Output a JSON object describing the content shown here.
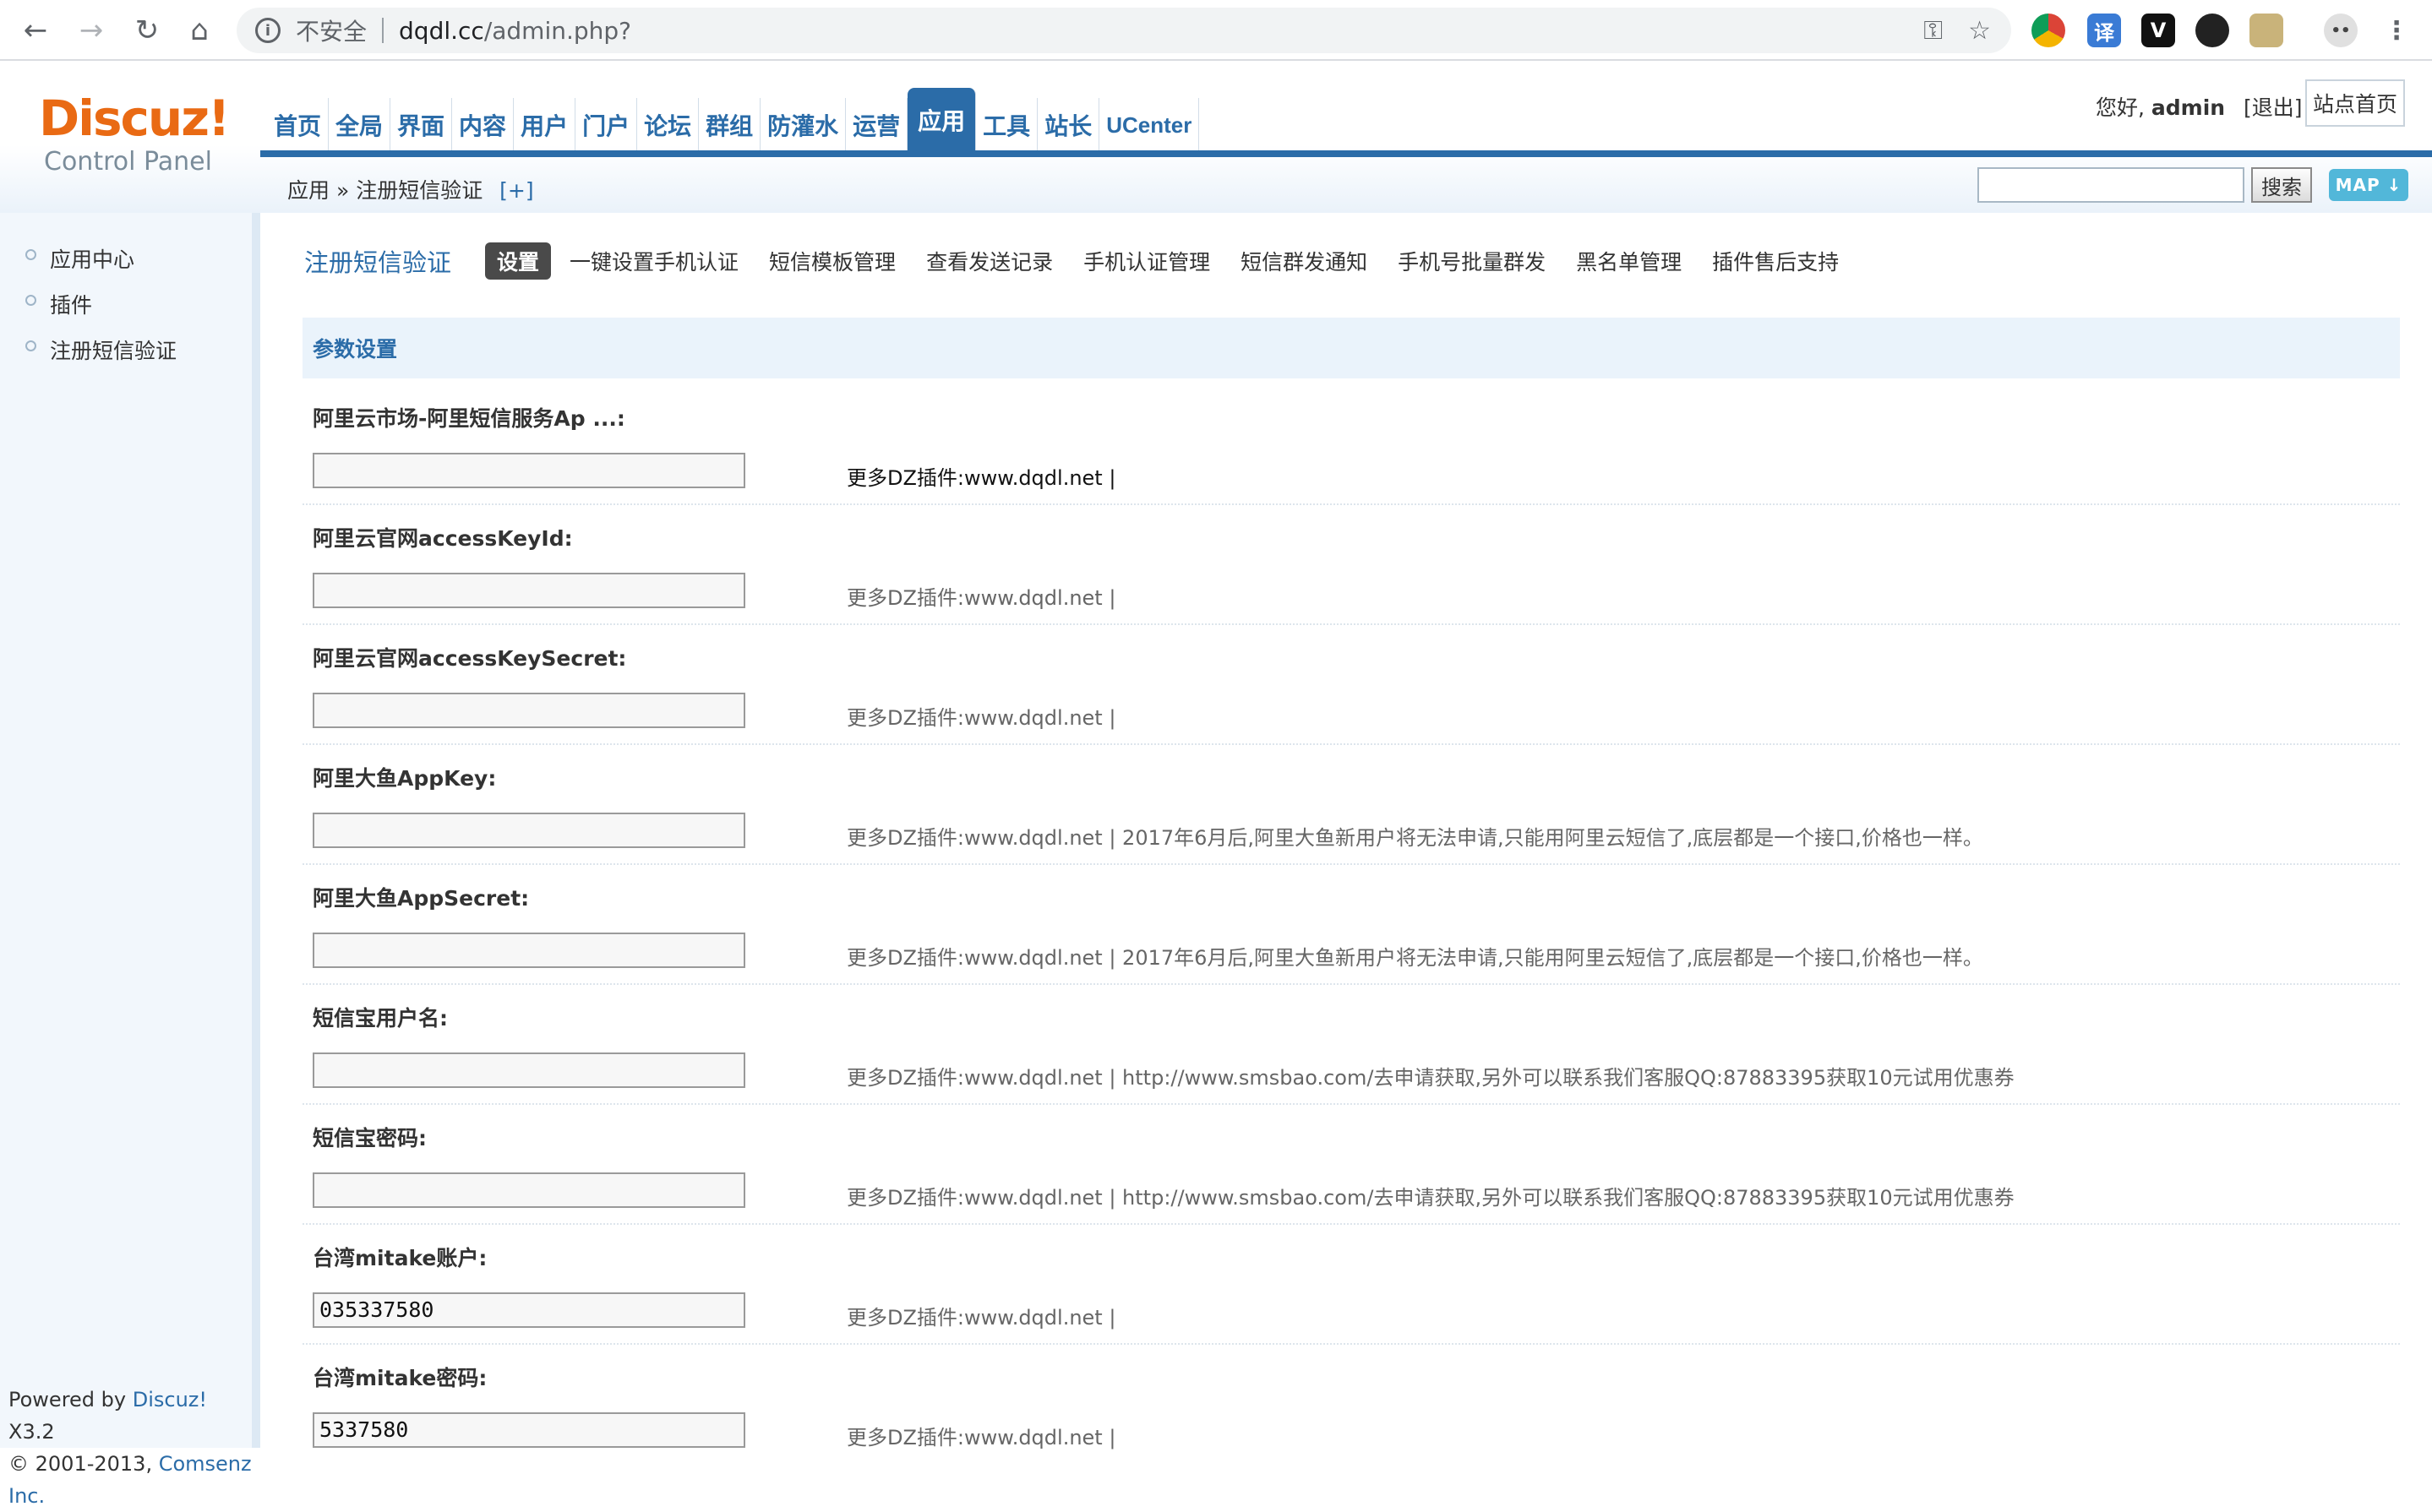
{
  "browser": {
    "insecure_label": "不安全",
    "url_host": "dqdl.cc",
    "url_path": "/admin.php?"
  },
  "header": {
    "logo_main": "Discuz!",
    "logo_sub": "Control Panel",
    "nav": [
      "首页",
      "全局",
      "界面",
      "内容",
      "用户",
      "门户",
      "论坛",
      "群组",
      "防灌水",
      "运营",
      "应用",
      "工具",
      "站长",
      "UCenter"
    ],
    "active_nav": "应用",
    "greeting": "您好,",
    "username": "admin",
    "logout": "[退出]",
    "site_home": "站点首页",
    "breadcrumb": "应用 » 注册短信验证",
    "breadcrumb_plus": "[+]",
    "search_button": "搜索",
    "map_button": "MAP"
  },
  "sidebar": {
    "items": [
      "应用中心",
      "插件",
      "注册短信验证"
    ],
    "powered_prefix": "Powered by",
    "powered_brand": "Discuz!",
    "powered_version": "X3.2",
    "copyright_prefix": "© 2001-2013,",
    "copyright_company": "Comsenz Inc."
  },
  "main": {
    "plugin_title": "注册短信验证",
    "tabs": [
      "设置",
      "一键设置手机认证",
      "短信模板管理",
      "查看发送记录",
      "手机认证管理",
      "短信群发通知",
      "手机号批量群发",
      "黑名单管理",
      "插件售后支持"
    ],
    "section_title": "参数设置",
    "settings": [
      {
        "label": "阿里云市场-阿里短信服务Ap ...:",
        "value": "",
        "tip": "更多DZ插件:www.dqdl.net |"
      },
      {
        "label": "阿里云官网accessKeyId:",
        "value": "",
        "tip": "更多DZ插件:www.dqdl.net |"
      },
      {
        "label": "阿里云官网accessKeySecret:",
        "value": "",
        "tip": "更多DZ插件:www.dqdl.net |"
      },
      {
        "label": "阿里大鱼AppKey:",
        "value": "",
        "tip": "更多DZ插件:www.dqdl.net | 2017年6月后,阿里大鱼新用户将无法申请,只能用阿里云短信了,底层都是一个接口,价格也一样。"
      },
      {
        "label": "阿里大鱼AppSecret:",
        "value": "",
        "tip": "更多DZ插件:www.dqdl.net | 2017年6月后,阿里大鱼新用户将无法申请,只能用阿里云短信了,底层都是一个接口,价格也一样。"
      },
      {
        "label": "短信宝用户名:",
        "value": "",
        "tip": "更多DZ插件:www.dqdl.net | http://www.smsbao.com/去申请获取,另外可以联系我们客服QQ:87883395获取10元试用优惠券"
      },
      {
        "label": "短信宝密码:",
        "value": "",
        "tip": "更多DZ插件:www.dqdl.net | http://www.smsbao.com/去申请获取,另外可以联系我们客服QQ:87883395获取10元试用优惠券"
      },
      {
        "label": "台湾mitake账户:",
        "value": "035337580",
        "tip": "更多DZ插件:www.dqdl.net |"
      },
      {
        "label": "台湾mitake密码:",
        "value": "5337580",
        "tip": "更多DZ插件:www.dqdl.net |"
      }
    ]
  },
  "colors": {
    "accent": "#2b6ca8",
    "logo": "#e96a14",
    "map_button": "#52b7d9"
  }
}
